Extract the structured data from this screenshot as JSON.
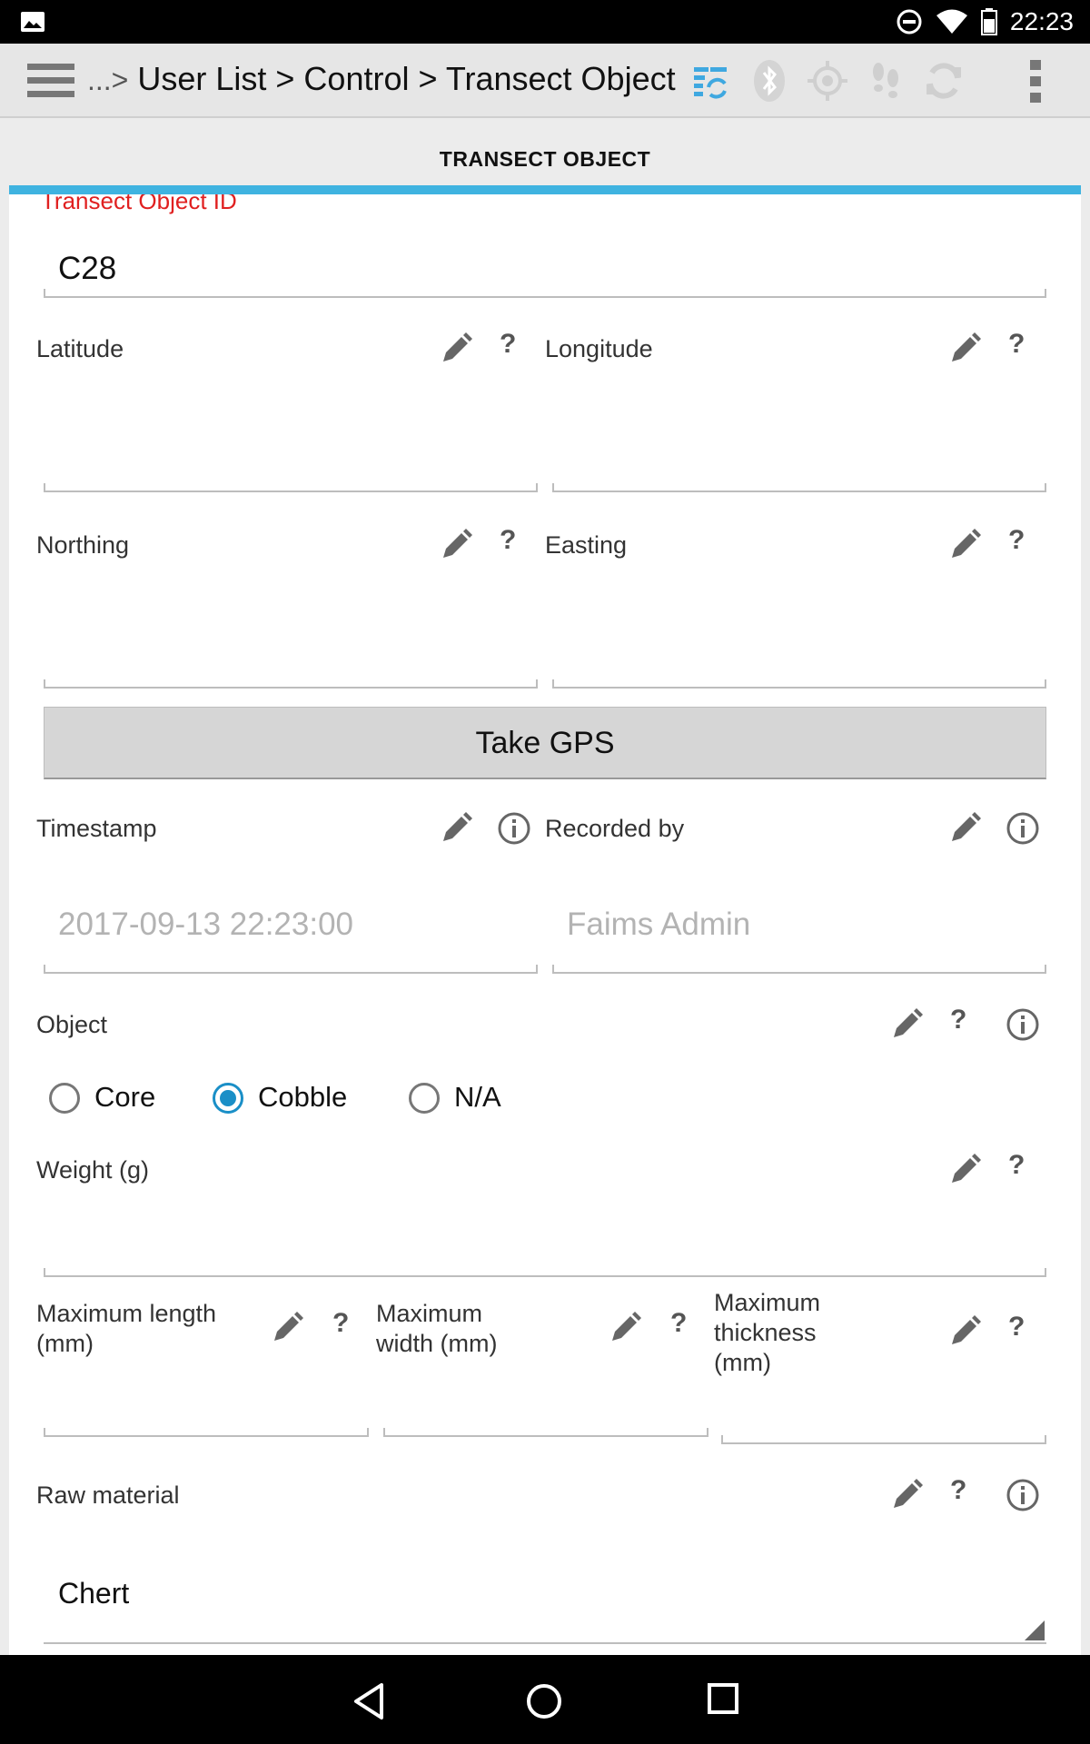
{
  "status_bar": {
    "time": "22:23"
  },
  "action_bar": {
    "breadcrumb_ellipsis": "...>",
    "breadcrumb": " User List > Control > Transect Object",
    "icons": [
      "sync-icon",
      "bluetooth-icon",
      "gps-icon",
      "tracklog-icon",
      "refresh-icon",
      "overflow-menu-icon"
    ]
  },
  "tab": {
    "label": "TRANSECT OBJECT",
    "accent_color": "#3fb3e0"
  },
  "form": {
    "id_label": "Transect Object ID",
    "id_value": "C28",
    "latitude_label": "Latitude",
    "longitude_label": "Longitude",
    "northing_label": "Northing",
    "easting_label": "Easting",
    "take_gps_label": "Take GPS",
    "timestamp_label": "Timestamp",
    "timestamp_value": "2017-09-13 22:23:00",
    "recorded_by_label": "Recorded by",
    "recorded_by_value": "Faims Admin",
    "object_label": "Object",
    "object_options": [
      "Core",
      "Cobble",
      "N/A"
    ],
    "object_selected": "Cobble",
    "weight_label": "Weight (g)",
    "max_length_label": "Maximum length (mm)",
    "max_width_label": "Maximum width (mm)",
    "max_thickness_label": "Maximum thickness (mm)",
    "raw_material_label": "Raw material",
    "raw_material_value": "Chert"
  }
}
